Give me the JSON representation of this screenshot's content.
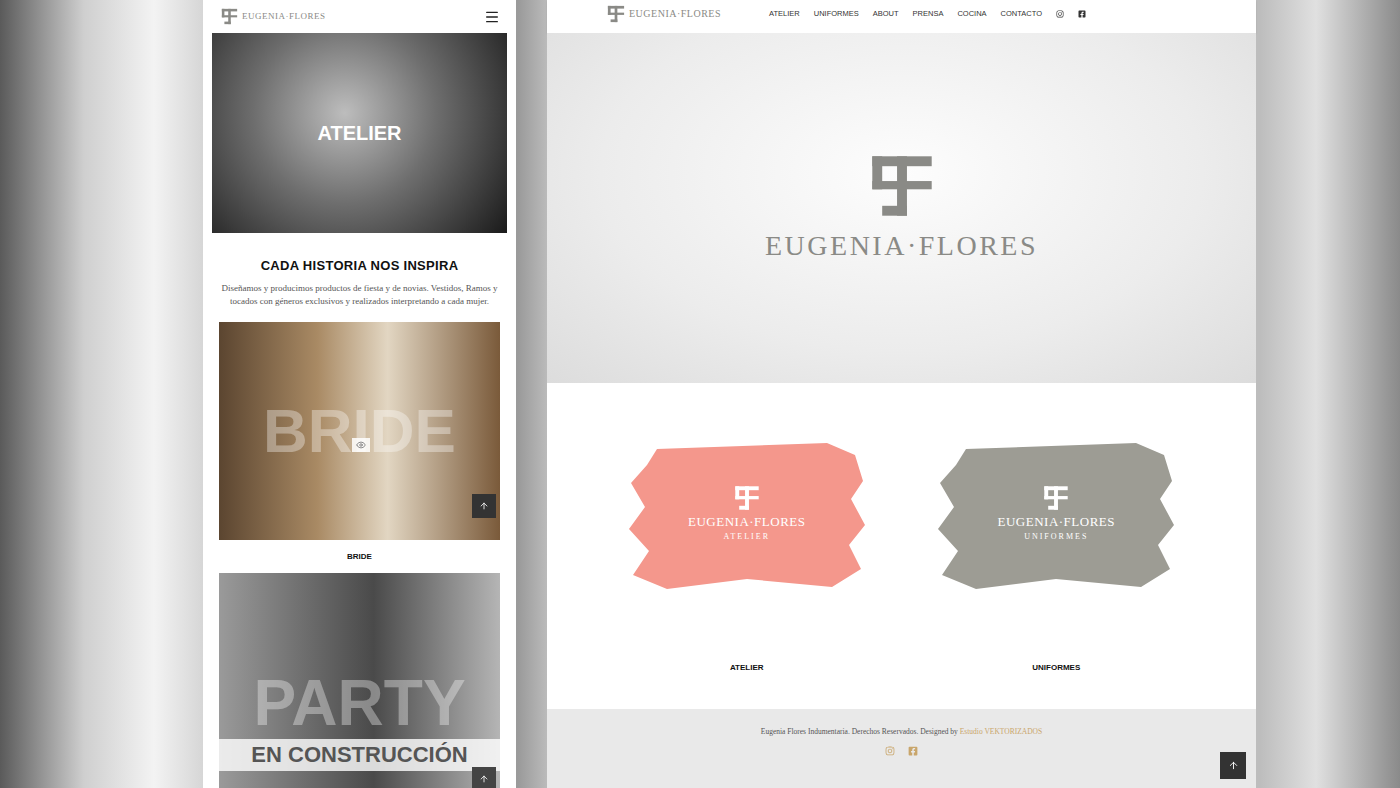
{
  "mobile": {
    "brand": "EUGENIA·FLORES",
    "hero": "ATELIER",
    "heading": "CADA HISTORIA NOS INSPIRA",
    "intro": "Diseñamos y producimos productos de fiesta y de novias. Vestidos, Ramos y tocados con géneros exclusivos y realizados interpretando a cada mujer.",
    "cards": [
      {
        "kind": "collection",
        "watermark": "BRIDE",
        "label": "BRIDE"
      },
      {
        "kind": "construction",
        "watermark": "PARTY",
        "banner": "EN CONSTRUCCIÓN"
      }
    ]
  },
  "desktop": {
    "brand": "EUGENIA·FLORES",
    "nav": [
      {
        "label": "ATELIER",
        "selected": false
      },
      {
        "label": "UNIFORMES",
        "selected": false
      },
      {
        "label": "ABOUT",
        "selected": false
      },
      {
        "label": "PRENSA",
        "selected": false
      },
      {
        "label": "COCINA",
        "selected": false
      },
      {
        "label": "CONTACTO",
        "selected": false
      }
    ],
    "hero_brand": "EUGENIA·FLORES",
    "divisions": [
      {
        "brand": "EUGENIA·FLORES",
        "sub": "ATELIER",
        "label": "ATELIER",
        "color": "#f4978c"
      },
      {
        "brand": "EUGENIA·FLORES",
        "sub": "UNIFORMES",
        "label": "UNIFORMES",
        "color": "#9d9c94"
      }
    ],
    "footer": {
      "text": "Eugenia Flores Indumentaria. Derechos Reservados. Designed by",
      "link": "Estudio VEKTORIZADOS"
    }
  }
}
